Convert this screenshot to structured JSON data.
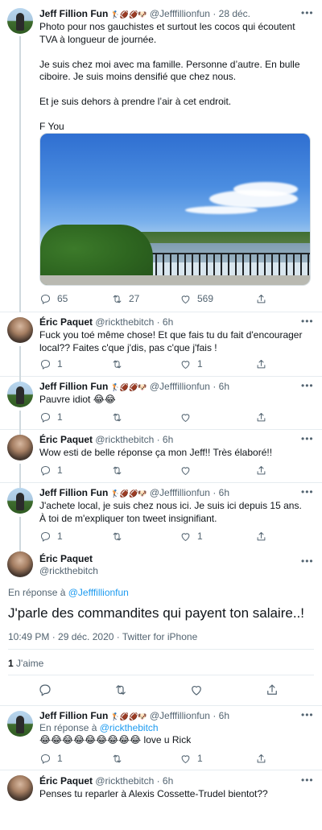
{
  "tweets": [
    {
      "name": "Jeff Fillion Fun",
      "emojis": "🏌️🏈🏈🐶",
      "handle": "@Jefffillionfun",
      "time": "· 28 déc.",
      "text": "Photo pour nos gauchistes et surtout les cocos qui écoutent TVA à longueur de journée.\n\nJe suis chez moi avec ma famille. Personne d’autre. En bulle ciboire. Je suis moins densifié que chez nous.\n\nEt je suis dehors à prendre l’air à cet endroit.\n\nF You",
      "replies": "65",
      "retweets": "27",
      "likes": "569"
    },
    {
      "name": "Éric Paquet",
      "handle": "@rickthebitch",
      "time": "· 6h",
      "text": "Fuck you toé même chose! Et que fais tu du fait d'encourager local?? Faites c'que j'dis, pas c'que j'fais !",
      "replies": "1",
      "retweets": "",
      "likes": "1"
    },
    {
      "name": "Jeff Fillion Fun",
      "emojis": "🏌️🏈🏈🐶",
      "handle": "@Jefffillionfun",
      "time": "· 6h",
      "text": "Pauvre idiot 😂😂",
      "replies": "1",
      "retweets": "",
      "likes": ""
    },
    {
      "name": "Éric Paquet",
      "handle": "@rickthebitch",
      "time": "· 6h",
      "text": "Wow esti de belle réponse ça mon Jeff!! Très élaboré!!",
      "replies": "1",
      "retweets": "",
      "likes": ""
    },
    {
      "name": "Jeff Fillion Fun",
      "emojis": "🏌️🏈🏈🐶",
      "handle": "@Jefffillionfun",
      "time": "· 6h",
      "text": "J'achete local, je suis chez nous ici. Je suis ici depuis 15 ans. À toi de m'expliquer ton tweet insignifiant.",
      "replies": "1",
      "retweets": "",
      "likes": "1"
    }
  ],
  "main_tweet": {
    "name": "Éric Paquet",
    "handle": "@rickthebitch",
    "reply_prefix": "En réponse à",
    "reply_to": "@Jefffillionfun",
    "text": "J'parle des commandites qui payent ton salaire..!",
    "meta": "10:49 PM · 29 déc. 2020 · ",
    "source": "Twitter for iPhone",
    "likes_count": "1",
    "likes_label": "J'aime"
  },
  "replies": [
    {
      "name": "Jeff Fillion Fun",
      "emojis": "🏌️🏈🏈🐶",
      "handle": "@Jefffillionfun",
      "time": "· 6h",
      "reply_prefix": "En réponse à",
      "reply_to": "@rickthebitch",
      "text": "😂😂😂😂😂😂😂😂😂 love u Rick",
      "replies": "1",
      "retweets": "",
      "likes": "1"
    },
    {
      "name": "Éric Paquet",
      "handle": "@rickthebitch",
      "time": "· 6h",
      "text": "Penses tu reparler à Alexis Cossette-Trudel bientot??"
    }
  ],
  "icons": [
    "reply-icon",
    "retweet-icon",
    "like-icon",
    "share-icon",
    "more-icon"
  ],
  "colors": {
    "link": "#1d9bf0",
    "muted": "#536471",
    "text": "#0f1419",
    "border": "#e6ecf0"
  }
}
